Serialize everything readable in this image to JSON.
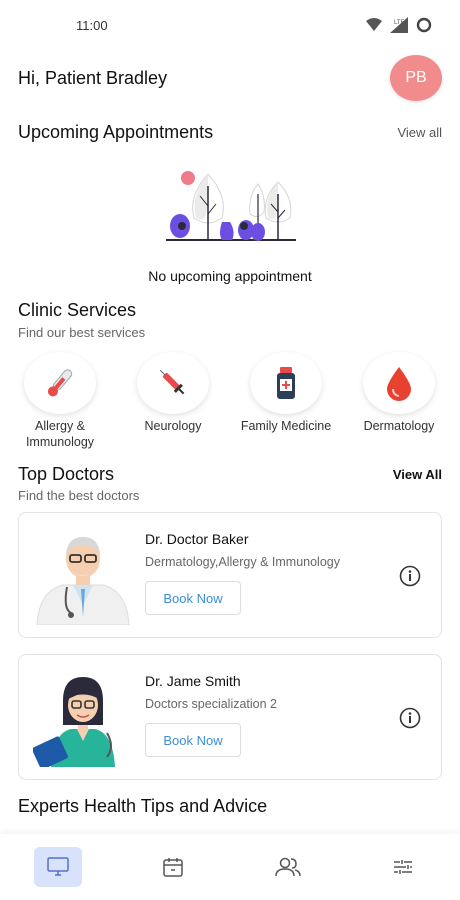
{
  "status_bar": {
    "time": "11:00",
    "network": "LTE"
  },
  "greeting": {
    "text": "Hi, Patient Bradley",
    "avatar_initials": "PB",
    "avatar_color": "#f28c8c"
  },
  "appointments": {
    "title": "Upcoming Appointments",
    "view_all": "View all",
    "empty_text": "No upcoming appointment"
  },
  "services": {
    "title": "Clinic Services",
    "subtitle": "Find our best services",
    "items": [
      {
        "label": "Allergy & Immunology",
        "icon": "thermometer-icon"
      },
      {
        "label": "Neurology",
        "icon": "syringe-icon"
      },
      {
        "label": "Family Medicine",
        "icon": "medicine-bottle-icon"
      },
      {
        "label": "Dermatology",
        "icon": "blood-drop-icon"
      }
    ]
  },
  "doctors": {
    "title": "Top Doctors",
    "view_all": "View All",
    "subtitle": "Find the best doctors",
    "items": [
      {
        "name": "Dr. Doctor Baker",
        "specialization": "Dermatology,Allergy & Immunology",
        "button": "Book Now"
      },
      {
        "name": "Dr. Jame Smith",
        "specialization": "Doctors specialization 2",
        "button": "Book Now"
      }
    ]
  },
  "tips": {
    "title": "Experts Health Tips and Advice"
  },
  "bottom_nav": {
    "items": [
      {
        "icon": "monitor-icon",
        "active": true
      },
      {
        "icon": "calendar-icon",
        "active": false
      },
      {
        "icon": "users-icon",
        "active": false
      },
      {
        "icon": "settings-sliders-icon",
        "active": false
      }
    ],
    "active_bg": "#d8e2fb"
  },
  "colors": {
    "link_blue": "#3a8fd6",
    "accent_purple": "#6c4fe0"
  }
}
